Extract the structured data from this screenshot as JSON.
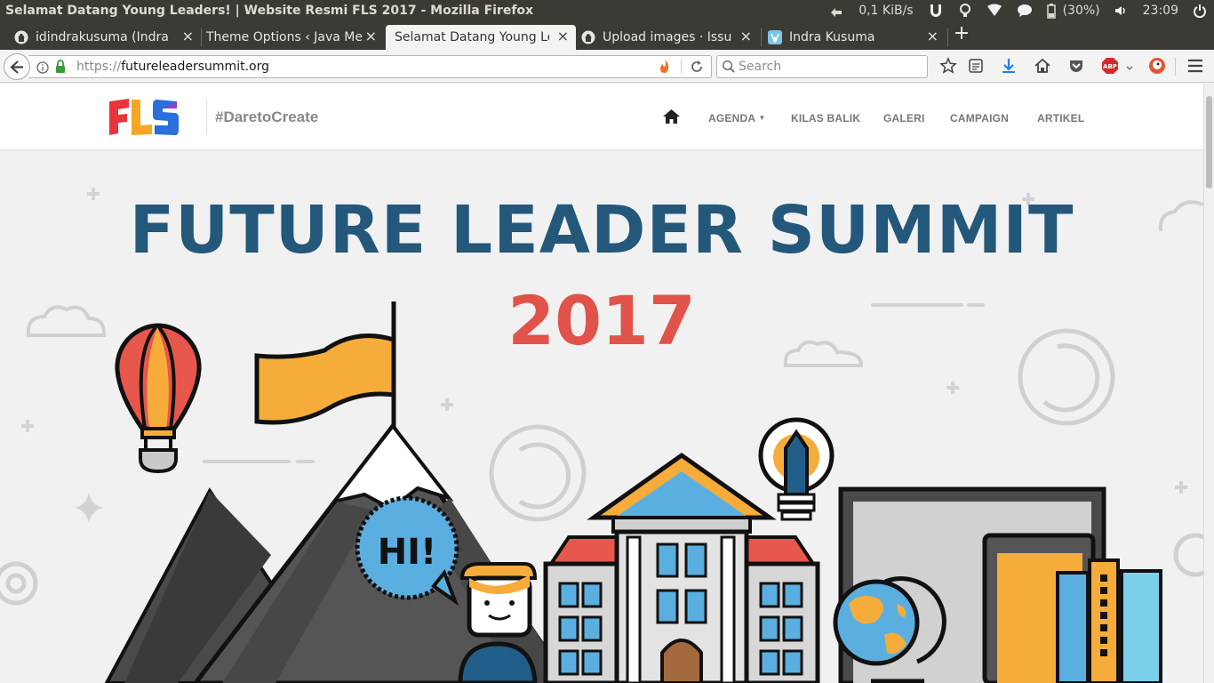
{
  "os_panel": {
    "window_title": "Selamat Datang Young Leaders! | Website Resmi FLS 2017 - Mozilla Firefox",
    "net_speed": "0,1 KiB/s",
    "battery": "(30%)",
    "clock": "23:09"
  },
  "tabs": [
    {
      "label": "idindrakusuma (Indra K"
    },
    {
      "label": "Theme Options ‹ Java Me"
    },
    {
      "label": "Selamat Datang Young Le"
    },
    {
      "label": "Upload images · Issue #"
    },
    {
      "label": "Indra Kusuma"
    }
  ],
  "urlbar": {
    "scheme": "https://",
    "host": "futureleadersummit.org"
  },
  "searchbar": {
    "placeholder": "Search"
  },
  "site": {
    "logo_text": "FLS",
    "tagline": "#DaretoCreate",
    "nav": {
      "agenda": "AGENDA",
      "kilas_balik": "KILAS BALIK",
      "galeri": "GALERI",
      "campaign": "CAMPAIGN",
      "artikel": "ARTIKEL"
    },
    "hero_title": "FUTURE LEADER SUMMIT",
    "hero_year": "2017",
    "speech_bubble": "HI!"
  },
  "colors": {
    "title_blue": "#23587a",
    "year_red": "#e1524a",
    "flag_orange": "#f6ac3b",
    "sky_blue": "#5bafe0",
    "mountain_dark": "#4a4a4a"
  }
}
